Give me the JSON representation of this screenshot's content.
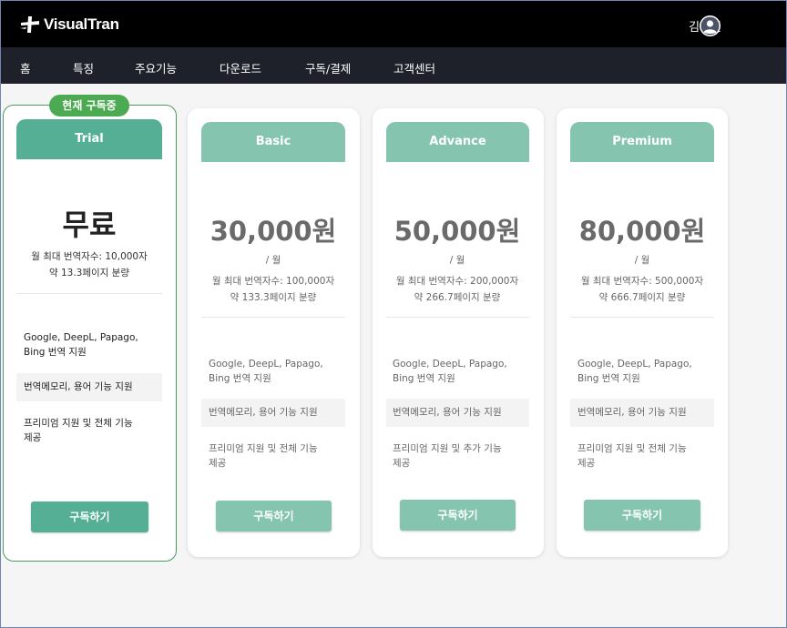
{
  "colors": {
    "topbar": "#000000",
    "navbar": "#1f212a",
    "accent_current": "#55af94",
    "accent_plan": "#85c5b0",
    "badge": "#4caa52",
    "current_border": "#4a9a5c"
  },
  "header": {
    "logo_text": "VisualTran",
    "user_name": "김창선",
    "avatar_icon": "user-circle-icon"
  },
  "nav": {
    "items": [
      {
        "label": "홈"
      },
      {
        "label": "특징"
      },
      {
        "label": "주요기능"
      },
      {
        "label": "다운로드"
      },
      {
        "label": "구독/결제"
      },
      {
        "label": "고객센터"
      }
    ]
  },
  "plans": [
    {
      "badge": "현재 구독중",
      "name": "Trial",
      "price": "무료",
      "max_chars": "월 최대 번역자수: 10,000자",
      "pages": "약 13.3페이지 분량",
      "features": [
        "Google, DeepL, Papago,",
        "Bing 번역 지원",
        "번역메모리, 용어 기능 지원",
        "프리미엄 지원 및 전체 기능",
        "제공"
      ],
      "button": "구독하기"
    },
    {
      "name": "Basic",
      "price": "30,000원",
      "period": "/ 월",
      "max_chars": "월 최대 번역자수: 100,000자",
      "pages": "약 133.3페이지 분량",
      "features": [
        "Google, DeepL, Papago,",
        "Bing 번역 지원",
        "번역메모리, 용어 기능 지원",
        "프리미엄 지원 및 전체 기능",
        "제공"
      ],
      "button": "구독하기"
    },
    {
      "name": "Advance",
      "price": "50,000원",
      "period": "/ 월",
      "max_chars": "월 최대 번역자수: 200,000자",
      "pages": "약 266.7페이지 분량",
      "features": [
        "Google, DeepL, Papago,",
        "Bing 번역 지원",
        "번역메모리, 용어 기능 지원",
        "프리미엄 지원 및 추가 기능",
        "제공"
      ],
      "button": "구독하기"
    },
    {
      "name": "Premium",
      "price": "80,000원",
      "period": "/ 월",
      "max_chars": "월 최대 번역자수: 500,000자",
      "pages": "약 666.7페이지 분량",
      "features": [
        "Google, DeepL, Papago,",
        "Bing 번역 지원",
        "번역메모리, 용어 기능 지원",
        "프리미엄 지원 및 전체 기능",
        "제공"
      ],
      "button": "구독하기"
    }
  ]
}
